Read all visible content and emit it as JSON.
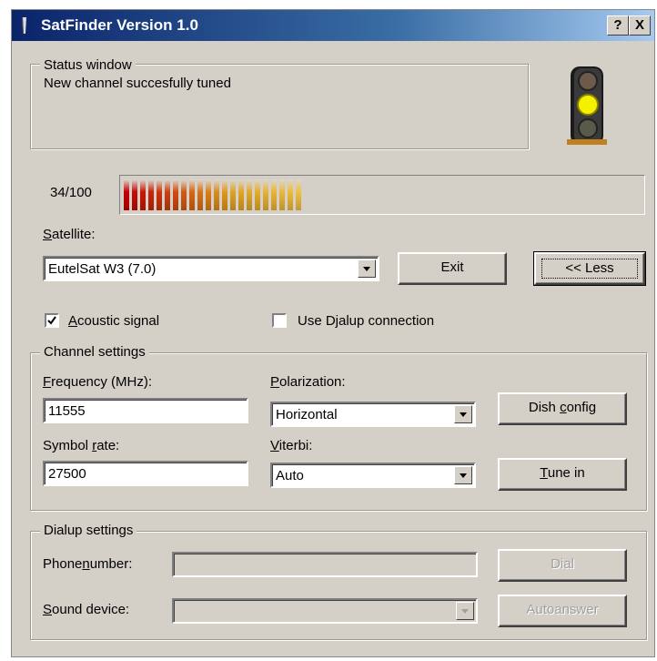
{
  "window": {
    "title": "SatFinder Version 1.0",
    "help_label": "?",
    "close_label": "X"
  },
  "status": {
    "group_label": "Status window",
    "message": "New channel succesfully tuned"
  },
  "signal": {
    "label": "34/100",
    "value": 34,
    "max": 100
  },
  "satellite": {
    "label": "Satellite:",
    "selected": "EutelSat W3 (7.0)"
  },
  "buttons": {
    "exit": "Exit",
    "less": "<< Less",
    "dish_config": "Dish config",
    "tune_in": "Tune in",
    "dial": "Dial",
    "autoanswer": "Autoanswer"
  },
  "options": {
    "acoustic_label": "Acoustic signal",
    "acoustic_checked": true,
    "dialup_label": "Use Djalup connection",
    "dialup_checked": false
  },
  "channel": {
    "group_label": "Channel settings",
    "frequency_label": "Frequency (MHz):",
    "frequency_value": "11555",
    "polarization_label": "Polarization:",
    "polarization_value": "Horizontal",
    "symbol_label": "Symbol rate:",
    "symbol_value": "27500",
    "viterbi_label": "Viterbi:",
    "viterbi_value": "Auto"
  },
  "dialup": {
    "group_label": "Dialup settings",
    "phone_label": "Phonenumber:",
    "phone_value": "",
    "sound_label": "Sound device:",
    "sound_value": ""
  },
  "traffic_light": {
    "active": "yellow",
    "colors": {
      "red_off": "#6e5a4a",
      "yellow_on": "#f4f000",
      "green_off": "#5a5a4a"
    }
  },
  "signal_colors": [
    "#c40000",
    "#e0a020",
    "#f0c040"
  ]
}
